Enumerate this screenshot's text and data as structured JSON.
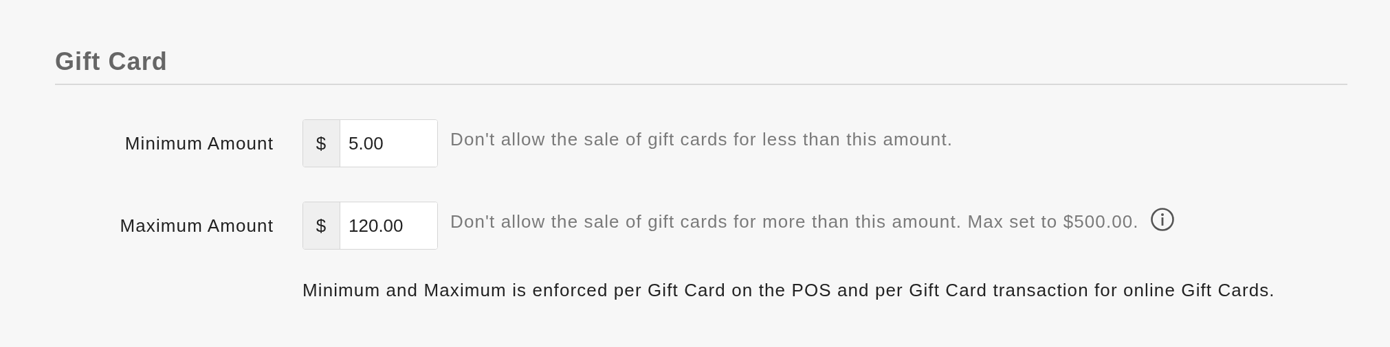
{
  "section": {
    "title": "Gift Card"
  },
  "fields": [
    {
      "label": "Minimum Amount",
      "prefix": "$",
      "value": "5.00",
      "help": "Don't allow the sale of gift cards for less than this amount.",
      "info_icon": false
    },
    {
      "label": "Maximum Amount",
      "prefix": "$",
      "value": "120.00",
      "help": "Don't allow the sale of gift cards for more than this amount. Max set to $500.00.",
      "info_icon": true
    }
  ],
  "note": "Minimum and Maximum is enforced per Gift Card on the POS and per Gift Card transaction for online Gift Cards."
}
